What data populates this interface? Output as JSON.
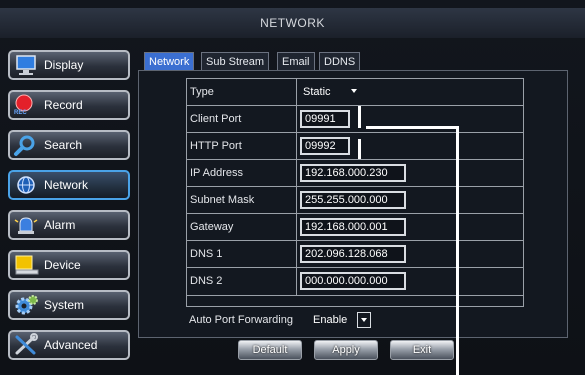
{
  "header": {
    "title": "NETWORK"
  },
  "sidebar": {
    "items": [
      {
        "label": "Display",
        "icon": "monitor-icon"
      },
      {
        "label": "Record",
        "icon": "record-icon",
        "sublabel": "REC"
      },
      {
        "label": "Search",
        "icon": "search-icon"
      },
      {
        "label": "Network",
        "icon": "network-icon",
        "active": true
      },
      {
        "label": "Alarm",
        "icon": "alarm-icon"
      },
      {
        "label": "Device",
        "icon": "device-icon"
      },
      {
        "label": "System",
        "icon": "gear-icon"
      },
      {
        "label": "Advanced",
        "icon": "tools-icon"
      }
    ]
  },
  "tabs": [
    "Network",
    "Sub Stream",
    "Email",
    "DDNS"
  ],
  "settings": {
    "type": {
      "label": "Type",
      "value": "Static"
    },
    "client_port": {
      "label": "Client Port",
      "value": "09991"
    },
    "http_port": {
      "label": "HTTP Port",
      "value": "09992"
    },
    "ip_address": {
      "label": "IP Address",
      "value": "192.168.000.230"
    },
    "subnet_mask": {
      "label": "Subnet Mask",
      "value": "255.255.000.000"
    },
    "gateway": {
      "label": "Gateway",
      "value": "192.168.000.001"
    },
    "dns1": {
      "label": "DNS 1",
      "value": "202.096.128.068"
    },
    "dns2": {
      "label": "DNS 2",
      "value": "000.000.000.000"
    },
    "auto_port_forwarding": {
      "label": "Auto Port Forwarding",
      "value": "Enable"
    }
  },
  "buttons": {
    "default": "Default",
    "apply": "Apply",
    "exit": "Exit"
  },
  "colors": {
    "active_tab": "#3b6fd1",
    "active_sidebar_border": "#4aa3e8"
  }
}
